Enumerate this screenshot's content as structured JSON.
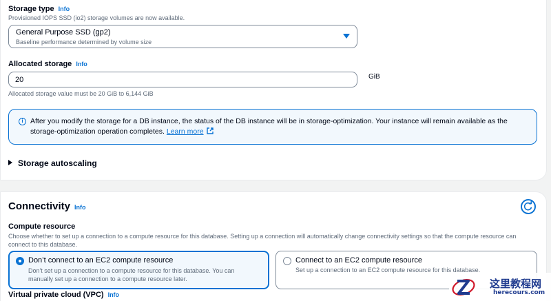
{
  "storage": {
    "type_label": "Storage type",
    "info": "Info",
    "type_desc": "Provisioned IOPS SSD (io2) storage volumes are now available.",
    "select_value": "General Purpose SSD (gp2)",
    "select_sub": "Baseline performance determined by volume size",
    "allocated_label": "Allocated storage",
    "allocated_value": "20",
    "unit": "GiB",
    "allocated_hint": "Allocated storage value must be 20 GiB to 6,144 GiB",
    "alert_text": "After you modify the storage for a DB instance, the status of the DB instance will be in storage-optimization. Your instance will remain available as the storage-optimization operation completes.",
    "alert_link": "Learn more",
    "autoscaling": "Storage autoscaling"
  },
  "connectivity": {
    "title": "Connectivity",
    "info": "Info",
    "compute_label": "Compute resource",
    "compute_desc": "Choose whether to set up a connection to a compute resource for this database. Setting up a connection will automatically change connectivity settings so that the compute resource can connect to this database.",
    "options": [
      {
        "title": "Don’t connect to an EC2 compute resource",
        "desc": "Don't set up a connection to a compute resource for this database. You can manually set up a connection to a compute resource later.",
        "selected": true
      },
      {
        "title": "Connect to an EC2 compute resource",
        "desc": "Set up a connection to an EC2 compute resource for this database.",
        "selected": false
      }
    ],
    "vpc_label": "Virtual private cloud (VPC)",
    "vpc_info": "Info"
  },
  "watermark": {
    "cn": "这里教程网",
    "url": "herecours.com"
  },
  "colors": {
    "accent": "#0972d3",
    "alert_bg": "#f2f8fd",
    "watermark": "#1f3b8f",
    "watermark_red": "#d0182a"
  }
}
